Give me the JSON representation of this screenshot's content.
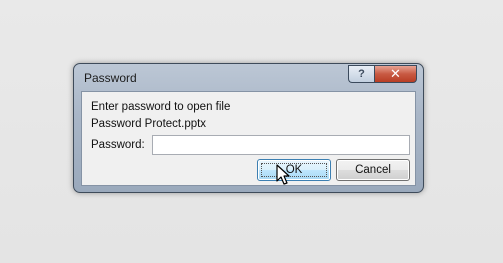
{
  "dialog": {
    "title": "Password",
    "help_glyph": "?",
    "close_glyph": "✕",
    "message_line1": "Enter password to open file",
    "message_line2": "Password Protect.pptx",
    "password_label": "Password:",
    "password_value": "",
    "ok_label": "OK",
    "cancel_label": "Cancel"
  },
  "colors": {
    "frame": "#a9b6c7",
    "close_button": "#c85a43",
    "ok_button_border": "#3c7fb1"
  },
  "icons": {
    "help": "help-icon",
    "close": "close-icon",
    "cursor": "mouse-pointer-icon"
  }
}
